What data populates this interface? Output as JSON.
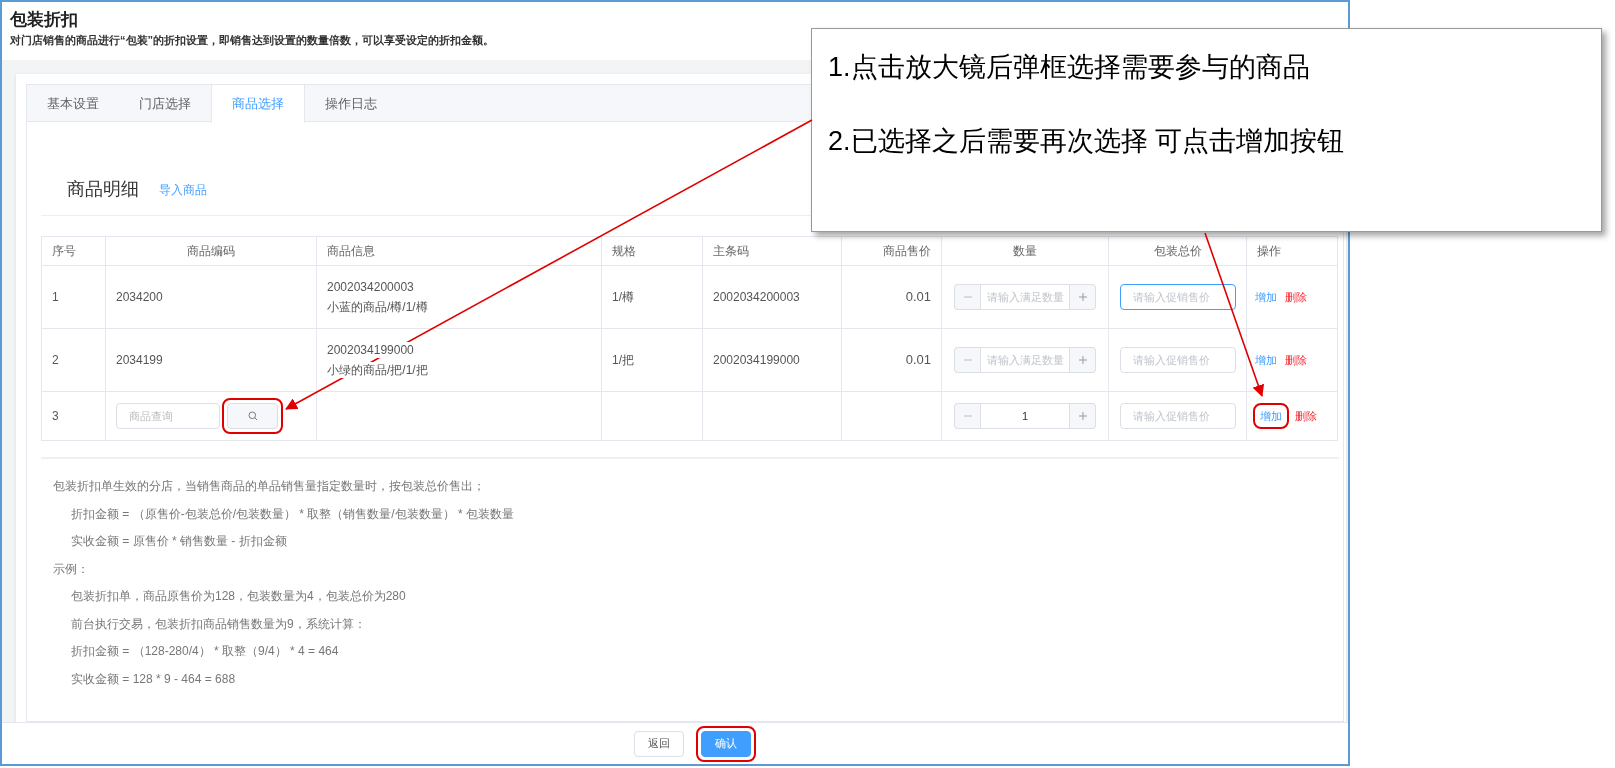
{
  "page": {
    "title": "包装折扣",
    "description": "对门店销售的商品进行“包装”的折扣设置，即销售达到设置的数量倍数，可以享受设定的折扣金额。"
  },
  "tabs": [
    {
      "label": "基本设置",
      "selected": false
    },
    {
      "label": "门店选择",
      "selected": false
    },
    {
      "label": "商品选择",
      "selected": true
    },
    {
      "label": "操作日志",
      "selected": false
    }
  ],
  "section": {
    "title": "商品明细",
    "link": "导入商品"
  },
  "table": {
    "columns": [
      "序号",
      "商品编码",
      "商品信息",
      "规格",
      "主条码",
      "商品售价",
      "数量",
      "包装总价",
      "操作"
    ],
    "rows": [
      {
        "index": "1",
        "code": "2034200",
        "info": [
          "2002034200003",
          "小蓝的商品/樽/1/樽"
        ],
        "spec": "1/樽",
        "barcode": "2002034200003",
        "price": "0.01",
        "quantity": {
          "placeholder": "请输入满足数量"
        },
        "package_price": {
          "placeholder": "请输入促销售价",
          "focused": true
        },
        "actions": [
          {
            "label": "增加",
            "kind": "add",
            "highlighted": false
          },
          {
            "label": "删除",
            "kind": "delete",
            "highlighted": false
          }
        ]
      },
      {
        "index": "2",
        "code": "2034199",
        "info": [
          "2002034199000",
          "小绿的商品/把/1/把"
        ],
        "spec": "1/把",
        "barcode": "2002034199000",
        "price": "0.01",
        "quantity": {
          "placeholder": "请输入满足数量"
        },
        "package_price": {
          "placeholder": "请输入促销售价",
          "focused": false
        },
        "actions": [
          {
            "label": "增加",
            "kind": "add",
            "highlighted": false
          },
          {
            "label": "删除",
            "kind": "delete",
            "highlighted": false
          }
        ]
      },
      {
        "index": "3",
        "code_search": {
          "placeholder": "商品查询",
          "highlighted": true
        },
        "quantity": {
          "value": "1"
        },
        "package_price": {
          "placeholder": "请输入促销售价",
          "focused": false
        },
        "actions": [
          {
            "label": "增加",
            "kind": "add",
            "highlighted": true
          },
          {
            "label": "删除",
            "kind": "delete",
            "highlighted": false
          }
        ]
      }
    ]
  },
  "notes": [
    {
      "text": "包装折扣单生效的分店，当销售商品的单品销售量指定数量时，按包装总价售出；",
      "children": [
        {
          "text": "折扣金额 = （原售价-包装总价/包装数量） * 取整（销售数量/包装数量） * 包装数量"
        },
        {
          "text": "实收金额 = 原售价 * 销售数量 - 折扣金额"
        }
      ]
    },
    {
      "text": "示例：",
      "children": [
        {
          "text": "包装折扣单，商品原售价为128，包装数量为4，包装总价为280"
        },
        {
          "text": "前台执行交易，包装折扣商品销售数量为9，系统计算："
        },
        {
          "text": "折扣金额 = （128-280/4） * 取整（9/4） * 4 = 464"
        },
        {
          "text": "实收金额 = 128 * 9 - 464 = 688"
        }
      ]
    }
  ],
  "buttons": [
    {
      "label": "返回",
      "kind": "default",
      "highlighted": false
    },
    {
      "label": "确认",
      "kind": "primary",
      "highlighted": true
    }
  ],
  "callout": {
    "lines": [
      "1.点击放大镜后弹框选择需要参与的商品",
      "2.已选择之后需要再次选择 可点击增加按钮"
    ]
  }
}
